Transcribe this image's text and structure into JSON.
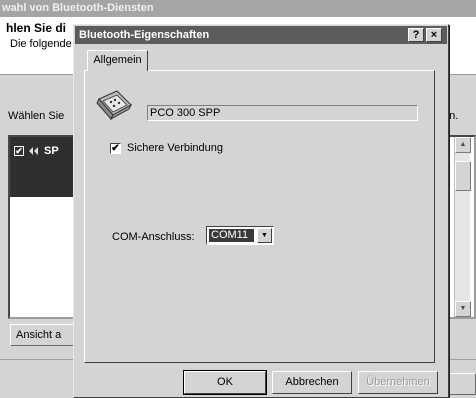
{
  "background_window": {
    "title": "wahl von Bluetooth-Diensten",
    "heading": "hlen Sie di",
    "subtext": "Die folgende",
    "choose_label": "Wählen Sie",
    "choose_label_tail": "en.",
    "list_item": "SP",
    "view_button": "Ansicht a"
  },
  "dialog": {
    "title": "Bluetooth-Eigenschaften",
    "help_button": "?",
    "close_button": "×",
    "tab_general": "Allgemein",
    "device_name": "PCO 300 SPP",
    "secure_checkbox_label": "Sichere Verbindung",
    "secure_checked": true,
    "com_port_label": "COM-Anschluss:",
    "com_port_value": "COM11",
    "buttons": {
      "ok": "OK",
      "cancel": "Abbrechen",
      "apply": "Übernehmen"
    }
  },
  "icons": {
    "checkmark": "✔",
    "dropdown": "▼",
    "scroll_up": "▲",
    "scroll_down": "▼",
    "bluetooth_serial": "serial-plug-icon"
  },
  "colors": {
    "titlebar_active": "#5c5c5c",
    "titlebar_inactive": "#a5a5a5",
    "selection": "#3a3a3a",
    "face": "#d4d4d4"
  }
}
